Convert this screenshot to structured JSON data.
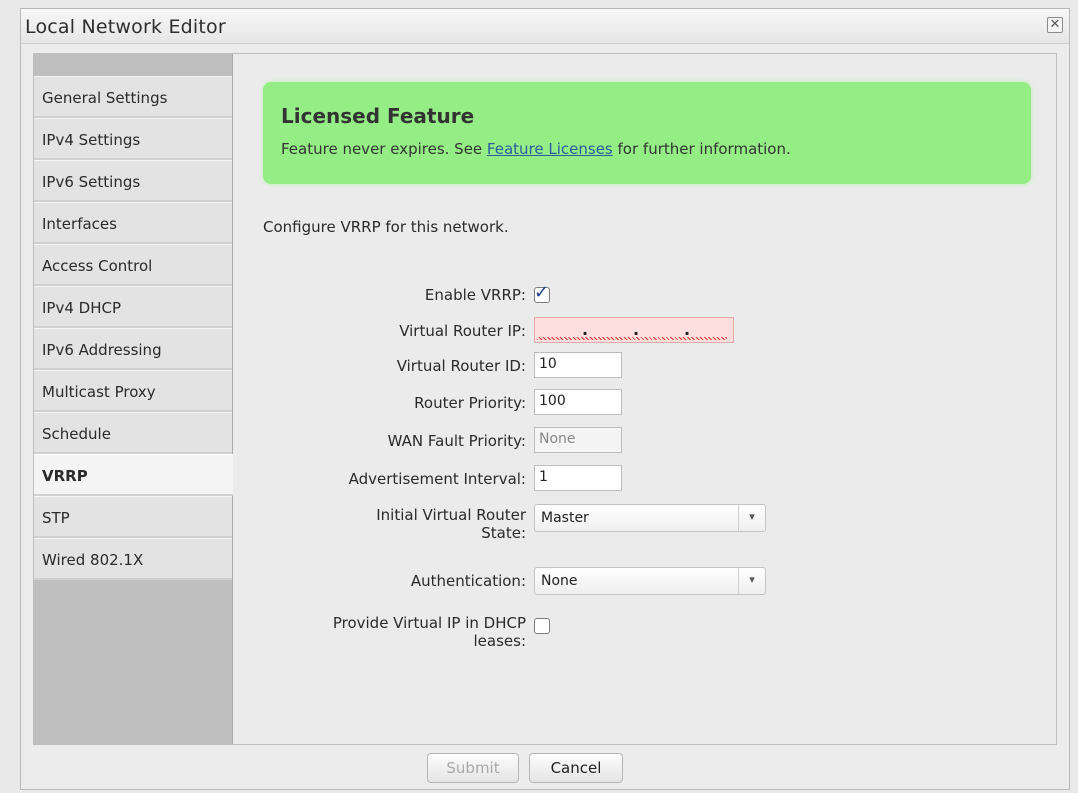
{
  "window": {
    "title": "Local Network Editor",
    "close_symbol": "✕"
  },
  "sidebar": {
    "items": [
      {
        "label": "General Settings",
        "active": false
      },
      {
        "label": "IPv4 Settings",
        "active": false
      },
      {
        "label": "IPv6 Settings",
        "active": false
      },
      {
        "label": "Interfaces",
        "active": false
      },
      {
        "label": "Access Control",
        "active": false
      },
      {
        "label": "IPv4 DHCP",
        "active": false
      },
      {
        "label": "IPv6 Addressing",
        "active": false
      },
      {
        "label": "Multicast Proxy",
        "active": false
      },
      {
        "label": "Schedule",
        "active": false
      },
      {
        "label": "VRRP",
        "active": true
      },
      {
        "label": "STP",
        "active": false
      },
      {
        "label": "Wired 802.1X",
        "active": false
      }
    ]
  },
  "license": {
    "title": "Licensed Feature",
    "text_before": "Feature never expires. See ",
    "link": "Feature Licenses",
    "text_after": " for further information.",
    "color": "#95ee85"
  },
  "intro": "Configure VRRP for this network.",
  "form": {
    "enable_vrrp": {
      "label": "Enable VRRP:",
      "checked": true,
      "check_symbol": "✓"
    },
    "virtual_router_ip": {
      "label": "Virtual Router IP:",
      "value": "",
      "dot": "."
    },
    "virtual_router_id": {
      "label": "Virtual Router ID:",
      "value": "10"
    },
    "router_priority": {
      "label": "Router Priority:",
      "value": "100"
    },
    "wan_fault_priority": {
      "label": "WAN Fault Priority:",
      "value": "None"
    },
    "advertisement_interval": {
      "label": "Advertisement Interval:",
      "value": "1"
    },
    "initial_state": {
      "label_line1": "Initial Virtual Router",
      "label_line2": "State:",
      "value": "Master"
    },
    "authentication": {
      "label": "Authentication:",
      "value": "None"
    },
    "provide_vip": {
      "label_line1": "Provide Virtual IP in DHCP",
      "label_line2": "leases:",
      "checked": false
    },
    "select_arrow": "▾"
  },
  "footer": {
    "submit_label": "Submit",
    "cancel_label": "Cancel"
  }
}
